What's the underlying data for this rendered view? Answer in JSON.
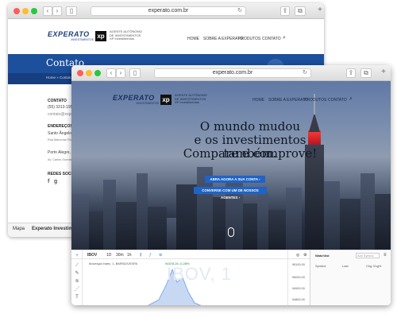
{
  "back_window": {
    "url": "experato.com.br",
    "logo": {
      "name": "EXPERATO",
      "sub": "INVESTIMENTOS",
      "xp": "xp",
      "agent_line1": "AGENTE AUTÔNOMO",
      "agent_line2": "DE INVESTIMENTOS",
      "agent_line3": "XP Investimentos"
    },
    "menu": [
      "HOME",
      "SOBRE A EXPERATO",
      "PRODUTOS",
      "CONTATO"
    ],
    "banner_title": "Contato",
    "breadcrumb": "Home » Contato",
    "contact": {
      "heading": "CONTATO",
      "phone": "(55) 3313-1952",
      "email": "contato@experato",
      "addresses_heading": "ENDEREÇOS",
      "city1": "Santo Ângelo, R",
      "street1": "Rua Marechal Floriano",
      "city2": "Porto Alegre, RS",
      "street2": "Av. Carlos Gomes, 2...",
      "social_heading": "REDES SOCIAIS",
      "social_icons": [
        "facebook-icon",
        "google-plus-icon"
      ]
    },
    "bottom_tabs": [
      "Mapa",
      "Experato Investimentos"
    ]
  },
  "front_window": {
    "url": "experato.com.br",
    "logo": {
      "name": "EXPERATO",
      "sub": "INVESTIMENTOS",
      "xp": "xp",
      "agent_line1": "AGENTE AUTÔNOMO",
      "agent_line2": "DE INVESTIMENTOS",
      "agent_line3": "XP Investimentos"
    },
    "menu": [
      "HOME",
      "SOBRE A EXPERATO",
      "PRODUTOS",
      "CONTATO"
    ],
    "hero_line1": "O mundo mudou",
    "hero_line2": "e os investimentos também.",
    "hero_line3": "Compare e comprove!",
    "cta_primary": "ABRA AGORA A SUA CONTA",
    "cta_secondary": "CONVERSE COM UM DE NOSSOS AGENTES",
    "trader": {
      "symbol": "IBOV",
      "intervals": [
        "1D",
        "30m",
        "1h"
      ],
      "chart_title": "Ibovespa Index, 1, BMFBOVESPA",
      "quote": "94578.26 -0.28%",
      "watermark": "IBOV, 1",
      "prices": [
        "95100.00",
        "95000.00",
        "94900.00",
        "94800.00"
      ],
      "watchlist_title": "Watchlist",
      "add_symbol_placeholder": "Add Symbol",
      "columns": [
        "Symbol",
        "Last",
        "Chg Chg%"
      ]
    }
  },
  "colors": {
    "brand_blue": "#1d3f7b",
    "banner_blue": "#1c4f9c",
    "cta_blue": "#1f63c6",
    "red_light": "#fd5f57",
    "yellow_light": "#febc2e",
    "green_light": "#28c840"
  }
}
